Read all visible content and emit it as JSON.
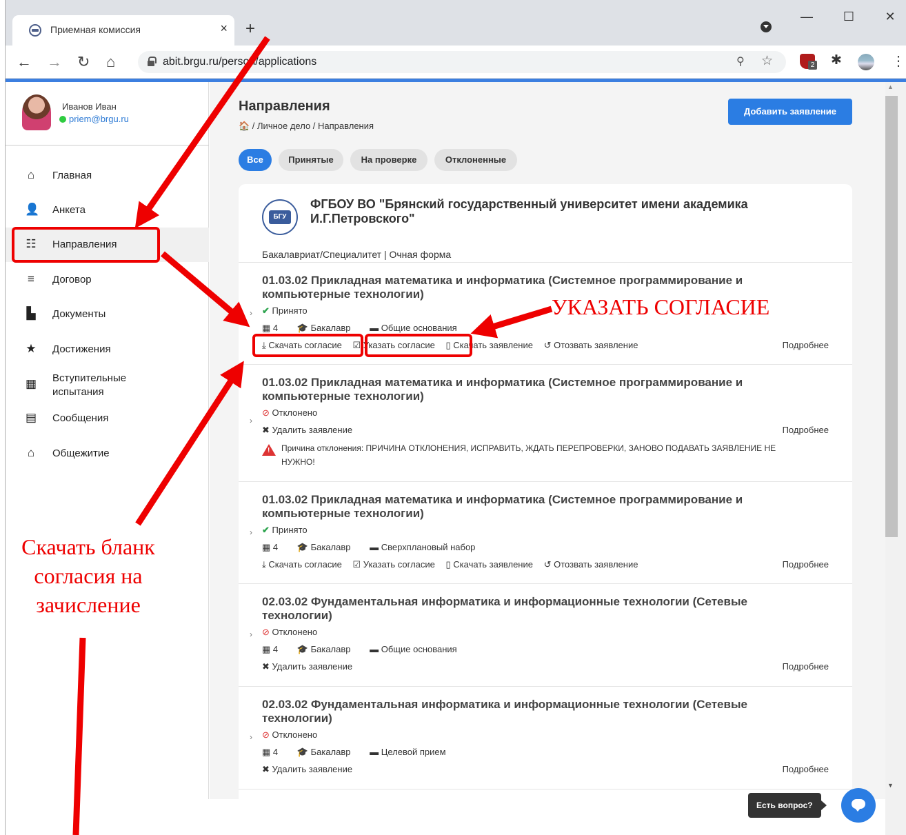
{
  "browser": {
    "tab_title": "Приемная комиссия",
    "tab_close": "×",
    "new_tab": "+",
    "url": "abit.brgu.ru/person/applications",
    "minimize": "—",
    "maximize": "☐",
    "close": "✕",
    "ext_badge": "2"
  },
  "user": {
    "name": "Иванов Иван",
    "email": "priem@brgu.ru"
  },
  "sidebar": {
    "items": [
      {
        "label": "Главная",
        "icon": "home-icon"
      },
      {
        "label": "Анкета",
        "icon": "person-icon"
      },
      {
        "label": "Направления",
        "icon": "list-icon"
      },
      {
        "label": "Договор",
        "icon": "contract-icon"
      },
      {
        "label": "Документы",
        "icon": "document-icon"
      },
      {
        "label": "Достижения",
        "icon": "star-icon"
      },
      {
        "label": "Вступительные испытания",
        "icon": "calendar-icon"
      },
      {
        "label": "Сообщения",
        "icon": "message-icon"
      },
      {
        "label": "Общежитие",
        "icon": "dormitory-icon"
      }
    ]
  },
  "page": {
    "title": "Направления",
    "breadcrumb": "🏠 / Личное дело / Направления",
    "add_button": "Добавить заявление",
    "filters": [
      "Все",
      "Принятые",
      "На проверке",
      "Отклоненные"
    ]
  },
  "university": {
    "name": "ФГБОУ ВО \"Брянский государственный университет имени академика И.Г.Петровского\"",
    "logo_text": "БГУ",
    "form": "Бакалавриат/Специалитет | Очная форма"
  },
  "applications": [
    {
      "title": "01.03.02 Прикладная математика и информатика (Системное программирование и компьютерные технологии)",
      "status": "Принято",
      "meta": [
        "4",
        "Бакалавр",
        "Общие основания"
      ],
      "actions": [
        "Скачать согласие",
        "Указать согласие",
        "Скачать заявление",
        "Отозвать заявление"
      ],
      "details": "Подробнее"
    },
    {
      "title": "01.03.02 Прикладная математика и информатика (Системное программирование и компьютерные технологии)",
      "status": "Отклонено",
      "actions": [
        "Удалить заявление"
      ],
      "reason": "Причина отклонения: ПРИЧИНА ОТКЛОНЕНИЯ, ИСПРАВИТЬ, ЖДАТЬ ПЕРЕПРОВЕРКИ, ЗАНОВО ПОДАВАТЬ ЗАЯВЛЕНИЕ НЕ НУЖНО!",
      "details": "Подробнее"
    },
    {
      "title": "01.03.02 Прикладная математика и информатика (Системное программирование и компьютерные технологии)",
      "status": "Принято",
      "meta": [
        "4",
        "Бакалавр",
        "Сверхплановый набор"
      ],
      "actions": [
        "Скачать согласие",
        "Указать согласие",
        "Скачать заявление",
        "Отозвать заявление"
      ],
      "details": "Подробнее"
    },
    {
      "title": "02.03.02 Фундаментальная информатика и информационные технологии (Сетевые технологии)",
      "status": "Отклонено",
      "meta": [
        "4",
        "Бакалавр",
        "Общие основания"
      ],
      "actions": [
        "Удалить заявление"
      ],
      "details": "Подробнее"
    },
    {
      "title": "02.03.02 Фундаментальная информатика и информационные технологии (Сетевые технологии)",
      "status": "Отклонено",
      "meta": [
        "4",
        "Бакалавр",
        "Целевой прием"
      ],
      "actions": [
        "Удалить заявление"
      ],
      "details": "Подробнее"
    }
  ],
  "chat": {
    "label": "Есть вопрос?"
  },
  "annotations": {
    "specify_consent": "УКАЗАТЬ СОГЛАСИЕ",
    "download_form": "Скачать бланк согласия на зачисление",
    "color": "#e00000"
  }
}
